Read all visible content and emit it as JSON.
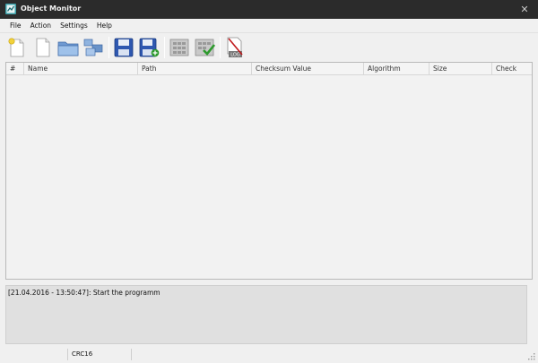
{
  "window": {
    "title": "Object Monitor",
    "close_glyph": "✕"
  },
  "menu": {
    "items": [
      {
        "label": "File"
      },
      {
        "label": "Action"
      },
      {
        "label": "Settings"
      },
      {
        "label": "Help"
      }
    ]
  },
  "toolbar": {
    "buttons": [
      {
        "icon": "new-file-icon"
      },
      {
        "icon": "blank-document-icon"
      },
      {
        "icon": "open-folder-icon"
      },
      {
        "icon": "add-objects-icon"
      },
      {
        "icon": "save-icon"
      },
      {
        "icon": "save-as-icon"
      },
      {
        "icon": "calculate-icon"
      },
      {
        "icon": "verify-checksum-icon"
      },
      {
        "icon": "no-log-icon",
        "text": "LOG"
      }
    ]
  },
  "table": {
    "columns": [
      {
        "label": "#"
      },
      {
        "label": "Name"
      },
      {
        "label": "Path"
      },
      {
        "label": "Checksum Value"
      },
      {
        "label": "Algorithm"
      },
      {
        "label": "Size"
      },
      {
        "label": "Check"
      }
    ],
    "rows": []
  },
  "log": {
    "lines": [
      "[21.04.2016 - 13:50:47]: Start the programm"
    ]
  },
  "statusbar": {
    "cells": [
      "",
      "CRC16",
      ""
    ]
  },
  "colors": {
    "titlebar": "#2b2b2b",
    "window_bg": "#f0f0f0",
    "log_bg": "#e0e0e0",
    "floppy_blue": "#2f58b0",
    "check_green": "#2e9a2e",
    "no_log_red": "#c0181b"
  }
}
